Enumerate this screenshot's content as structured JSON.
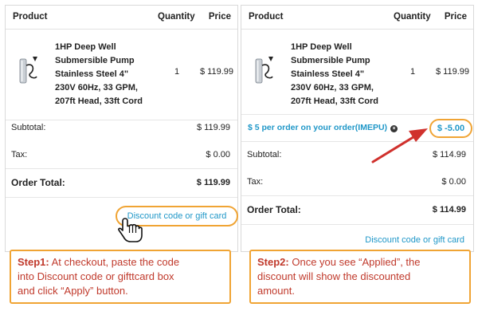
{
  "table_header": {
    "product": "Product",
    "quantity": "Quantity",
    "price": "Price"
  },
  "product": {
    "name_line1": "1HP Deep Well",
    "name_line2": "Submersible Pump",
    "name_line3": "Stainless Steel 4\"",
    "name_line4": "230V 60Hz, 33 GPM,",
    "name_line5": "207ft Head, 33ft Cord",
    "quantity": "1",
    "price": "$ 119.99"
  },
  "panel1": {
    "subtotal_label": "Subtotal:",
    "subtotal_value": "$ 119.99",
    "tax_label": "Tax:",
    "tax_value": "$ 0.00",
    "total_label": "Order Total:",
    "total_value": "$ 119.99",
    "discount_link": "Discount code or gift card"
  },
  "panel2": {
    "promo_text": "$ 5 per order on your order(IMEPU)",
    "promo_remove": "×",
    "promo_amount": "$ -5.00",
    "subtotal_label": "Subtotal:",
    "subtotal_value": "$ 114.99",
    "tax_label": "Tax:",
    "tax_value": "$ 0.00",
    "total_label": "Order Total:",
    "total_value": "$ 114.99",
    "discount_link": "Discount code or gift card"
  },
  "step1": {
    "label": "Step1:",
    "text_line1": " At checkout, paste the code",
    "text_line2": "into Discount code or gifttcard box",
    "text_line3": "and click “Apply” button."
  },
  "step2": {
    "label": "Step2:",
    "text_line1": " Once you see “Applied”, the",
    "text_line2": "discount will show the discounted",
    "text_line3": "amount."
  },
  "colors": {
    "accent_orange": "#f0a434",
    "link_blue": "#1f97c8",
    "step_red": "#c0392b",
    "arrow_red": "#d0312d"
  },
  "icons": [
    "pump-image",
    "pointer-hand-icon",
    "remove-x-icon",
    "red-arrow"
  ]
}
